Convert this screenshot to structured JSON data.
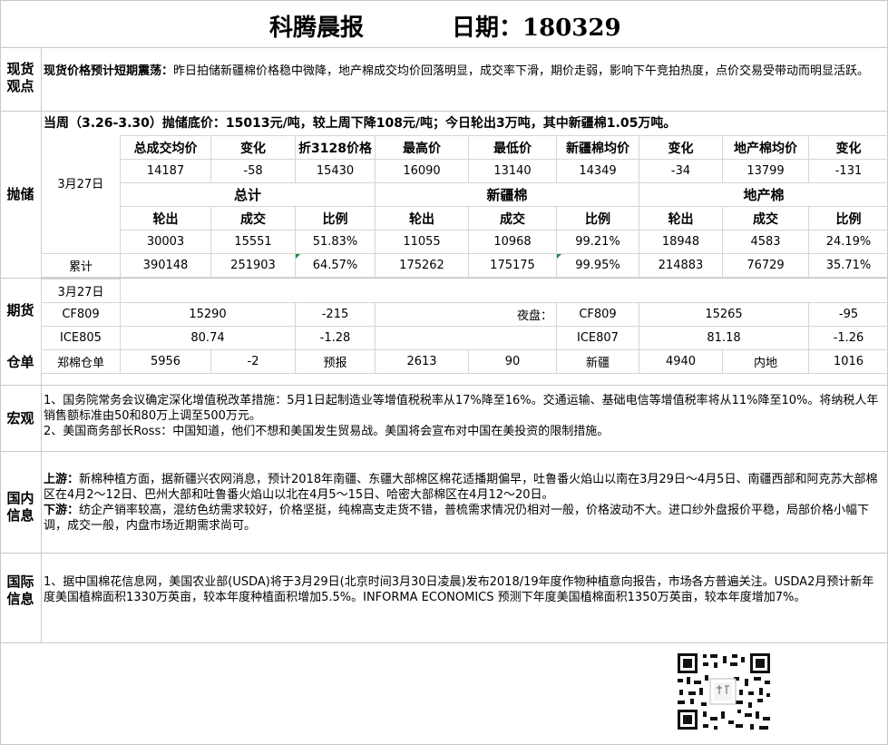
{
  "header": {
    "title": "科腾晨报",
    "date_label": "日期：180329"
  },
  "spot": {
    "label": "现货\n观点",
    "headline": "现货价格预计短期震荡：",
    "text": "昨日拍储新疆棉价格稳中微降，地产棉成交均价回落明显，成交率下滑，期价走弱，影响下午竞拍热度，点价交易受带动而明显活跃。"
  },
  "reserve": {
    "label": "抛储",
    "summary": "当周（3.26-3.30）抛储底价：15013元/吨，较上周下降108元/吨；今日轮出3万吨，其中新疆棉1.05万吨。",
    "date": "3月27日",
    "price_headers": [
      "总成交均价",
      "变化",
      "折3128价格",
      "最高价",
      "最低价",
      "新疆棉均价",
      "变化",
      "地产棉均价",
      "变化"
    ],
    "price_values": [
      "14187",
      "-58",
      "15430",
      "16090",
      "13140",
      "14349",
      "-34",
      "13799",
      "-131"
    ],
    "groups": [
      "总计",
      "新疆棉",
      "地产棉"
    ],
    "sub_headers": [
      "轮出",
      "成交",
      "比例",
      "轮出",
      "成交",
      "比例",
      "轮出",
      "成交",
      "比例"
    ],
    "day_values": [
      "30003",
      "15551",
      "51.83%",
      "11055",
      "10968",
      "99.21%",
      "18948",
      "4583",
      "24.19%"
    ],
    "cum_label": "累计",
    "cum_values": [
      "390148",
      "251903",
      "64.57%",
      "175262",
      "175175",
      "99.95%",
      "214883",
      "76729",
      "35.71%"
    ]
  },
  "futures": {
    "label": "期货",
    "date": "3月27日",
    "night_label": "夜盘：",
    "rows": [
      {
        "left_code": "CF809",
        "left_price": "15290",
        "left_change": "-215",
        "right_code": "CF809",
        "right_price": "15265",
        "right_change": "-95"
      },
      {
        "left_code": "ICE805",
        "left_price": "80.74",
        "left_change": "-1.28",
        "right_code": "ICE807",
        "right_price": "81.18",
        "right_change": "-1.26"
      }
    ]
  },
  "warehouse": {
    "label": "仓单",
    "name": "郑棉仓单",
    "value": "5956",
    "change": "-2",
    "forecast_label": "预报",
    "forecast_value": "2613",
    "forecast_change": "90",
    "xj_label": "新疆",
    "xj_value": "4940",
    "local_label": "内地",
    "local_value": "1016"
  },
  "macro": {
    "label": "宏观",
    "items": [
      "1、国务院常务会议确定深化增值税改革措施：5月1日起制造业等增值税税率从17%降至16%。交通运输、基础电信等增值税率将从11%降至10%。将纳税人年销售额标准由50和80万上调至500万元。",
      "2、美国商务部长Ross：中国知道，他们不想和美国发生贸易战。美国将会宣布对中国在美投资的限制措施。"
    ]
  },
  "domestic": {
    "label": "国内\n信息",
    "up_label": "上游：",
    "up_text": "新棉种植方面，据新疆兴农网消息，预计2018年南疆、东疆大部棉区棉花适播期偏早，吐鲁番火焰山以南在3月29日～4月5日、南疆西部和阿克苏大部棉区在4月2～12日、巴州大部和吐鲁番火焰山以北在4月5～15日、哈密大部棉区在4月12～20日。",
    "down_label": "下游：",
    "down_text": "纺企产销率较高，混纺色纺需求较好，价格坚挺，纯棉高支走货不错，普梳需求情况仍相对一般，价格波动不大。进口纱外盘报价平稳，局部价格小幅下调，成交一般，内盘市场近期需求尚可。"
  },
  "international": {
    "label": "国际\n信息",
    "text": "1、据中国棉花信息网，美国农业部(USDA)将于3月29日(北京时间3月30日凌晨)发布2018/19年度作物种植意向报告，市场各方普遍关注。USDA2月预计新年度美国植棉面积1330万英亩，较本年度种植面积增加5.5%。INFORMA ECONOMICS 预测下年度美国植棉面积1350万英亩，较本年度增加7%。"
  },
  "qr": {
    "icon": "qr-code-icon"
  }
}
